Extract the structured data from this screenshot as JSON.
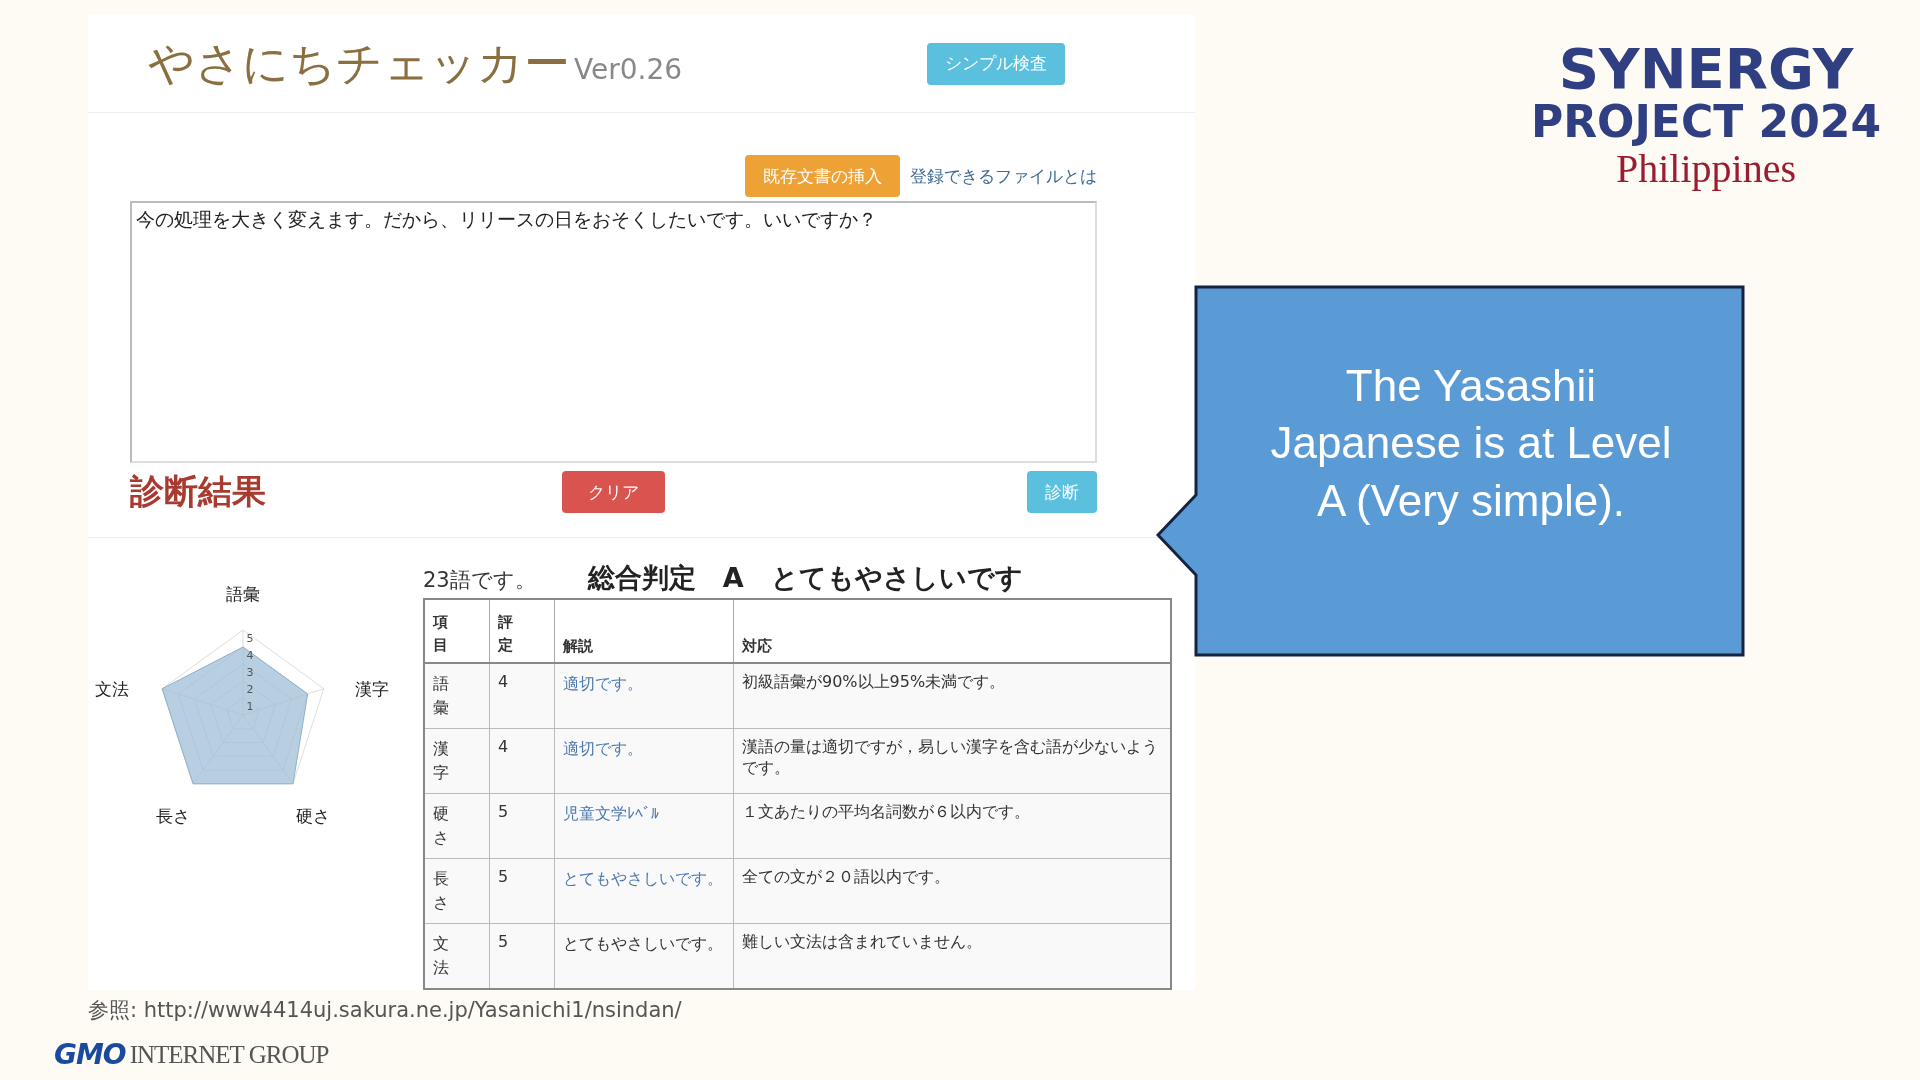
{
  "app": {
    "title": "やさにちチェッカー",
    "version": "Ver0.26",
    "simple_button": "シンプル検査",
    "insert_button": "既存文書の挿入",
    "files_link": "登録できるファイルとは",
    "input_text": "今の処理を大きく変えます。だから、リリースの日をおそくしたいです。いいですか？",
    "results_heading": "診断結果",
    "clear_button": "クリア",
    "diagnose_button": "診断"
  },
  "radar": {
    "ticks": [
      "5",
      "4",
      "3",
      "2",
      "1"
    ],
    "axes": [
      {
        "label": "語彙"
      },
      {
        "label": "漢字"
      },
      {
        "label": "硬さ"
      },
      {
        "label": "長さ"
      },
      {
        "label": "文法"
      }
    ]
  },
  "summary": {
    "word_count": "23語です。",
    "verdict": "総合判定　A　とてもやさしいです"
  },
  "table": {
    "columns": [
      "項目",
      "評定",
      "解説",
      "対応"
    ],
    "rows": [
      {
        "item": "語彙",
        "score": "4",
        "comment": "適切です。",
        "link": true,
        "action": "初級語彙が90%以上95%未満です。"
      },
      {
        "item": "漢字",
        "score": "4",
        "comment": "適切です。",
        "link": true,
        "action": "漢語の量は適切ですが，易しい漢字を含む語が少ないようです。"
      },
      {
        "item": "硬さ",
        "score": "5",
        "comment": "児童文学ﾚﾍﾞﾙ",
        "link": true,
        "action": "１文あたりの平均名詞数が６以内です。"
      },
      {
        "item": "長さ",
        "score": "5",
        "comment": "とてもやさしいです。",
        "link": true,
        "action": "全ての文が２０語以内です。"
      },
      {
        "item": "文法",
        "score": "5",
        "comment": "とてもやさしいです。",
        "link": false,
        "action": "難しい文法は含まれていません。"
      }
    ]
  },
  "source": "参照: http://www4414uj.sakura.ne.jp/Yasanichi1/nsindan/",
  "company_logo": {
    "mark": "GMO",
    "text": "INTERNET GROUP"
  },
  "event_logo": {
    "line1": "SYNERGY",
    "line2": "PROJECT 2024",
    "line3": "Philippines"
  },
  "callout": {
    "text": "The Yasashii Japanese is at Level A (Very simple)."
  }
}
